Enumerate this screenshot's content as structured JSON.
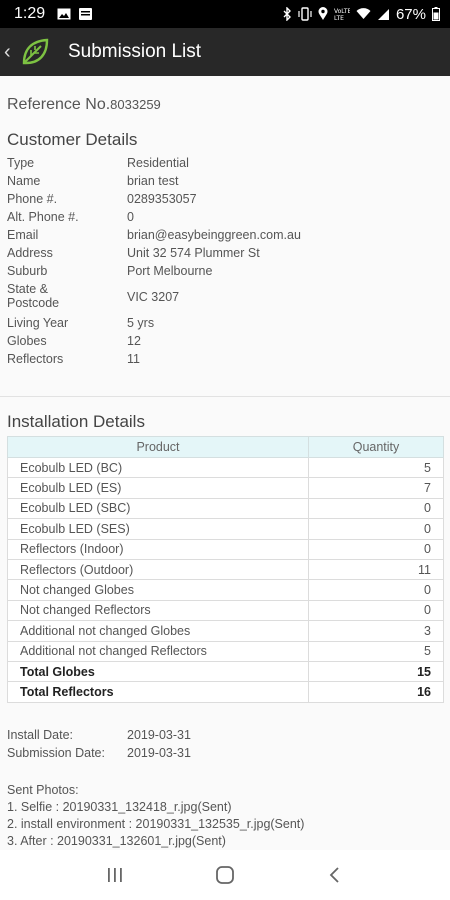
{
  "status_bar": {
    "time": "1:29",
    "battery": "67%",
    "icons": [
      "image-icon",
      "message-icon",
      "bluetooth-icon",
      "vibrate-icon",
      "location-icon",
      "volte-icon",
      "wifi-icon",
      "signal-icon",
      "battery-icon"
    ]
  },
  "app_bar": {
    "title": "Submission List"
  },
  "reference": {
    "label": "Reference No.",
    "number": "8033259"
  },
  "customer": {
    "heading": "Customer Details",
    "rows": [
      {
        "label": "Type",
        "value": "Residential"
      },
      {
        "label": "Name",
        "value": "brian test"
      },
      {
        "label": "Phone #.",
        "value": "0289353057"
      },
      {
        "label": "Alt. Phone #.",
        "value": "0"
      },
      {
        "label": "Email",
        "value": "brian@easybeinggreen.com.au"
      },
      {
        "label": "Address",
        "value": "Unit 32 574 Plummer St"
      },
      {
        "label": "Suburb",
        "value": "Port Melbourne"
      },
      {
        "label": "State &\nPostcode",
        "value": "VIC 3207"
      },
      {
        "label": "Living Year",
        "value": "5 yrs"
      },
      {
        "label": "Globes",
        "value": "12"
      },
      {
        "label": "Reflectors",
        "value": "11"
      }
    ]
  },
  "installation": {
    "heading": "Installation Details",
    "columns": [
      "Product",
      "Quantity"
    ],
    "rows": [
      {
        "product": "Ecobulb LED (BC)",
        "quantity": "5"
      },
      {
        "product": "Ecobulb LED (ES)",
        "quantity": "7"
      },
      {
        "product": "Ecobulb LED (SBC)",
        "quantity": "0"
      },
      {
        "product": "Ecobulb LED (SES)",
        "quantity": "0"
      },
      {
        "product": "Reflectors (Indoor)",
        "quantity": "0"
      },
      {
        "product": "Reflectors (Outdoor)",
        "quantity": "11"
      },
      {
        "product": "Not changed Globes",
        "quantity": "0"
      },
      {
        "product": "Not changed Reflectors",
        "quantity": "0"
      },
      {
        "product": "Additional not changed Globes",
        "quantity": "3"
      },
      {
        "product": "Additional not changed Reflectors",
        "quantity": "5"
      }
    ],
    "totals": [
      {
        "product": "Total Globes",
        "quantity": "15"
      },
      {
        "product": "Total Reflectors",
        "quantity": "16"
      }
    ]
  },
  "dates": {
    "install_label": "Install Date:",
    "install_value": "2019-03-31",
    "submission_label": "Submission Date:",
    "submission_value": "2019-03-31"
  },
  "photos": {
    "heading": "Sent Photos:",
    "items": [
      "1. Selfie : 20190331_132418_r.jpg(Sent)",
      "2. install environment : 20190331_132535_r.jpg(Sent)",
      "3. After : 20190331_132601_r.jpg(Sent)"
    ]
  }
}
